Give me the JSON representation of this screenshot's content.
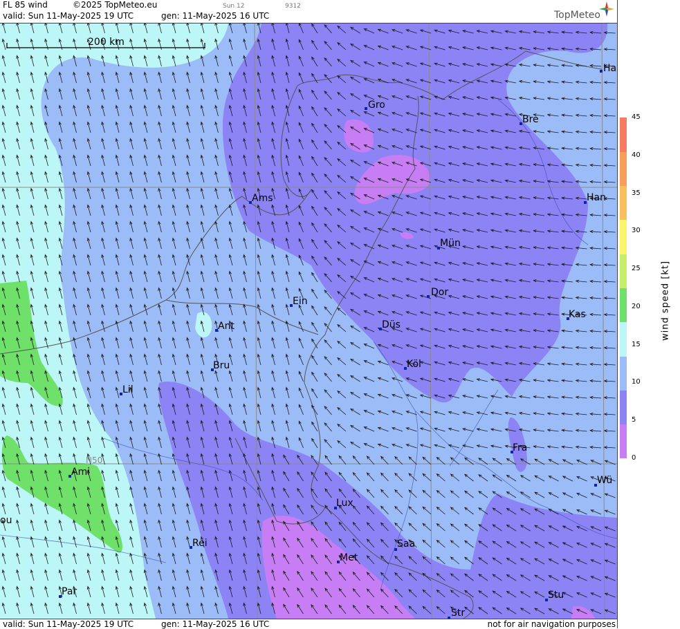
{
  "header": {
    "product": "FL 85 wind",
    "copyright": "©2025 TopMeteo.eu",
    "valid": "valid:  Sun  11-May-2025  19 UTC",
    "generated": "gen: 11-May-2025 16 UTC",
    "run_code": "Sun 12",
    "serial": "9312",
    "brand": "TopMeteo"
  },
  "scale_bar": {
    "label": "200 km"
  },
  "lat_label": "N50",
  "cities": [
    {
      "name": "Gro"
    },
    {
      "name": "Bre"
    },
    {
      "name": "Ha"
    },
    {
      "name": "Ams"
    },
    {
      "name": "Han"
    },
    {
      "name": "Mün"
    },
    {
      "name": "Ein"
    },
    {
      "name": "Dor"
    },
    {
      "name": "Kas"
    },
    {
      "name": "Ant"
    },
    {
      "name": "Düs"
    },
    {
      "name": "Bru"
    },
    {
      "name": "Köl"
    },
    {
      "name": "Lil"
    },
    {
      "name": "Fra"
    },
    {
      "name": "Ami"
    },
    {
      "name": "Wü"
    },
    {
      "name": "Lux"
    },
    {
      "name": "Rei"
    },
    {
      "name": "Saa"
    },
    {
      "name": "Met"
    },
    {
      "name": "ou"
    },
    {
      "name": "Par"
    },
    {
      "name": "Stu"
    },
    {
      "name": "Str"
    }
  ],
  "footer": {
    "valid": "valid:  Sun  11-May-2025  19 UTC",
    "generated": "gen: 11-May-2025 16 UTC",
    "disclaimer": "not for air navigation purposes"
  },
  "legend": {
    "title": "wind  speed  [kt]",
    "ticks": [
      "0",
      "5",
      "10",
      "15",
      "20",
      "25",
      "30",
      "35",
      "40",
      "45"
    ],
    "tick_values": [
      0,
      5,
      10,
      15,
      20,
      25,
      30,
      35,
      40,
      45
    ],
    "colors": [
      "#c77ef5",
      "#8c83f5",
      "#9bbcf6",
      "#bdf6f6",
      "#6fe06a",
      "#c5ef6b",
      "#f9f46a",
      "#f8c05c",
      "#f79e5b",
      "#f57b63"
    ]
  }
}
